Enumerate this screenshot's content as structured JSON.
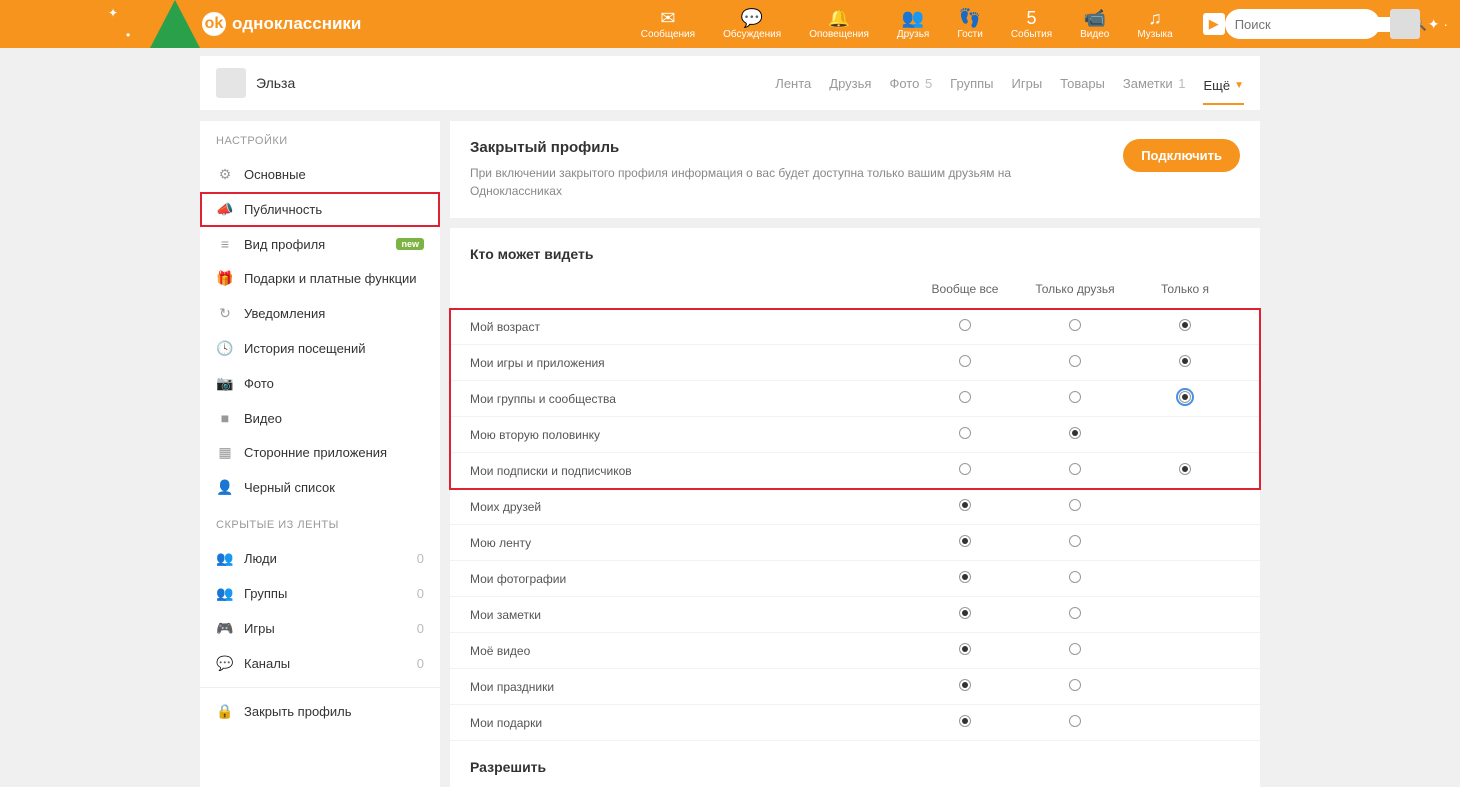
{
  "brand": "oдноклассники",
  "search": {
    "placeholder": "Поиск"
  },
  "topnav": [
    {
      "icon": "✉",
      "label": "Сообщения"
    },
    {
      "icon": "💬",
      "label": "Обсуждения"
    },
    {
      "icon": "🔔",
      "label": "Оповещения"
    },
    {
      "icon": "👥",
      "label": "Друзья"
    },
    {
      "icon": "👣",
      "label": "Гости"
    },
    {
      "icon": "5",
      "label": "События",
      "badge": "5"
    },
    {
      "icon": "📹",
      "label": "Видео"
    },
    {
      "icon": "♫",
      "label": "Музыка"
    }
  ],
  "profile": {
    "name": "Эльза"
  },
  "tabs": [
    {
      "label": "Лента"
    },
    {
      "label": "Друзья"
    },
    {
      "label": "Фото",
      "count": "5"
    },
    {
      "label": "Группы"
    },
    {
      "label": "Игры"
    },
    {
      "label": "Товары"
    },
    {
      "label": "Заметки",
      "count": "1"
    },
    {
      "label": "Ещё",
      "active": true
    }
  ],
  "sidebar": {
    "settings_header": "НАСТРОЙКИ",
    "hidden_header": "СКРЫТЫЕ ИЗ ЛЕНТЫ",
    "items1": [
      {
        "icon": "⚙",
        "label": "Основные"
      },
      {
        "icon": "📣",
        "label": "Публичность",
        "active": true
      },
      {
        "icon": "≡",
        "label": "Вид профиля",
        "badge": "new"
      },
      {
        "icon": "🎁",
        "label": "Подарки и платные функции"
      },
      {
        "icon": "↻",
        "label": "Уведомления"
      },
      {
        "icon": "🕓",
        "label": "История посещений"
      },
      {
        "icon": "📷",
        "label": "Фото"
      },
      {
        "icon": "■",
        "label": "Видео"
      },
      {
        "icon": "▦",
        "label": "Сторонние приложения"
      },
      {
        "icon": "👤",
        "label": "Черный список"
      }
    ],
    "items2": [
      {
        "icon": "👥",
        "label": "Люди",
        "count": "0"
      },
      {
        "icon": "👥",
        "label": "Группы",
        "count": "0"
      },
      {
        "icon": "🎮",
        "label": "Игры",
        "count": "0"
      },
      {
        "icon": "💬",
        "label": "Каналы",
        "count": "0"
      }
    ],
    "close_item": {
      "icon": "🔒",
      "label": "Закрыть профиль"
    }
  },
  "closed_profile": {
    "title": "Закрытый профиль",
    "desc": "При включении закрытого профиля информация о вас будет доступна только вашим друзьям на Одноклассниках",
    "button": "Подключить"
  },
  "who_can_see": {
    "title": "Кто может видеть",
    "columns": [
      "Вообще все",
      "Только друзья",
      "Только я"
    ],
    "rows_highlighted": [
      {
        "label": "Мой возраст",
        "sel": 2
      },
      {
        "label": "Мои игры и приложения",
        "sel": 2
      },
      {
        "label": "Мои группы и сообщества",
        "sel": 2,
        "focused": true
      },
      {
        "label": "Мою вторую половинку",
        "sel": 1,
        "cols": 2
      },
      {
        "label": "Мои подписки и подписчиков",
        "sel": 2
      }
    ],
    "rows_rest": [
      {
        "label": "Моих друзей",
        "sel": 0,
        "cols": 2
      },
      {
        "label": "Мою ленту",
        "sel": 0,
        "cols": 2
      },
      {
        "label": "Мои фотографии",
        "sel": 0,
        "cols": 2
      },
      {
        "label": "Мои заметки",
        "sel": 0,
        "cols": 2
      },
      {
        "label": "Моё видео",
        "sel": 0,
        "cols": 2
      },
      {
        "label": "Мои праздники",
        "sel": 0,
        "cols": 2
      },
      {
        "label": "Мои подарки",
        "sel": 0,
        "cols": 2
      }
    ]
  },
  "allow": {
    "title": "Разрешить"
  }
}
